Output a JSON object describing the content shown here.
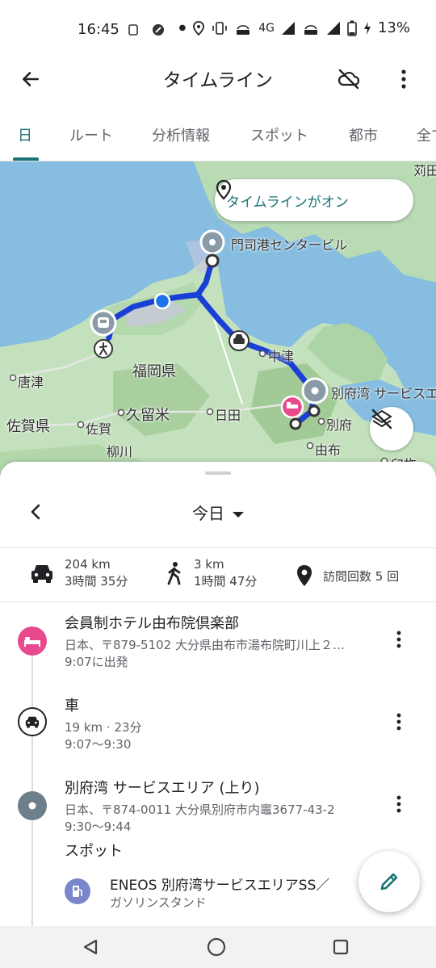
{
  "status_bar": {
    "time": "16:45",
    "network_label": "4G",
    "battery_percent": "13%"
  },
  "app_bar": {
    "title": "タイムライン",
    "back_icon": "arrow-back-icon",
    "cloud_icon": "cloud-off-icon",
    "more_icon": "more-vert-icon"
  },
  "tabs": [
    {
      "label": "日",
      "active": true
    },
    {
      "label": "ルート",
      "active": false
    },
    {
      "label": "分析情報",
      "active": false
    },
    {
      "label": "スポット",
      "active": false
    },
    {
      "label": "都市",
      "active": false
    },
    {
      "label": "全て",
      "active": false
    }
  ],
  "map": {
    "timeline_status": "タイムラインがオン",
    "labels": {
      "moji_port": "門司港センタービル",
      "fukuoka_pref": "福岡県",
      "nakatsu": "中津",
      "beppu_sa": "別府湾 サービスエリア",
      "karatsu": "唐津",
      "saga_pref": "佐賀県",
      "saga": "佐賀",
      "kurume": "久留米",
      "hita": "日田",
      "beppu": "別府",
      "yufu": "由布",
      "yanagawa": "柳川",
      "usuki": "臼杵",
      "kanda": "苅田"
    },
    "route_color": "#1a3fd6",
    "layers_icon": "layers-off-icon"
  },
  "sheet": {
    "date_label": "今日",
    "summary": {
      "drive_distance": "204 km",
      "drive_time": "3時間 35分",
      "walk_distance": "3 km",
      "walk_time": "1時間 47分",
      "visits": "訪問回数 5 回"
    },
    "entries": {
      "hotel": {
        "title": "会員制ホテル由布院倶楽部",
        "address": "日本、〒879-5102 大分県由布市湯布院町川上２…",
        "time": "9:07に出発",
        "icon": "hotel-icon",
        "color": "#e8488c"
      },
      "drive": {
        "title": "車",
        "detail": "19 km · 23分",
        "time": "9:07～9:30",
        "icon": "car-icon"
      },
      "sa": {
        "title": "別府湾 サービスエリア (上り)",
        "address": "日本、〒874-0011 大分県別府市内竈3677-43-2",
        "time": "9:30～9:44",
        "icon": "place-icon",
        "color": "#6d7f8b",
        "section": "スポット",
        "spot_name": "ENEOS 別府湾サービスエリアSS／",
        "spot_type": "ガソリンスタンド",
        "spot_icon": "gas-station-icon"
      }
    }
  },
  "fab_icon": "edit-pencil-icon",
  "nav_bar": {
    "back": "triangle-back-icon",
    "home": "circle-home-icon",
    "recents": "square-recents-icon"
  }
}
